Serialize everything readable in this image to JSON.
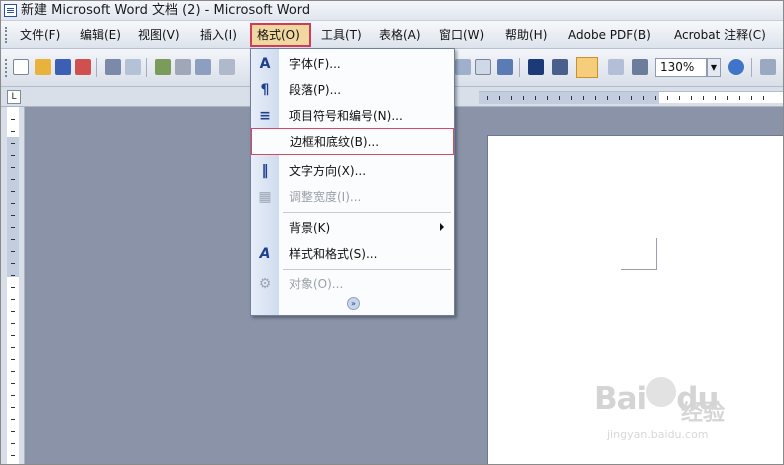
{
  "window": {
    "title": "新建 Microsoft Word 文档 (2) - Microsoft Word"
  },
  "menubar": {
    "items": [
      {
        "label": "文件(F)"
      },
      {
        "label": "编辑(E)"
      },
      {
        "label": "视图(V)"
      },
      {
        "label": "插入(I)"
      },
      {
        "label": "格式(O)"
      },
      {
        "label": "工具(T)"
      },
      {
        "label": "表格(A)"
      },
      {
        "label": "窗口(W)"
      },
      {
        "label": "帮助(H)"
      },
      {
        "label": "Adobe PDF(B)"
      },
      {
        "label": "Acrobat 注释(C)"
      }
    ],
    "active_index": 4
  },
  "toolbar": {
    "zoom_value": "130%",
    "zoom_arrow": "▼"
  },
  "ruler": {
    "tab_button": "L"
  },
  "format_menu": {
    "items": [
      {
        "icon": "A",
        "icon_name": "font-icon",
        "label": "字体(F)...",
        "disabled": false
      },
      {
        "icon": "¶",
        "icon_name": "paragraph-icon",
        "label": "段落(P)...",
        "disabled": false
      },
      {
        "icon": "≡",
        "icon_name": "bullets-numbering-icon",
        "label": "项目符号和编号(N)...",
        "disabled": false
      },
      {
        "icon": "",
        "icon_name": "",
        "label": "边框和底纹(B)...",
        "disabled": false,
        "highlighted": true
      },
      {
        "icon": "‖",
        "icon_name": "text-direction-icon",
        "label": "文字方向(X)...",
        "disabled": false
      },
      {
        "icon": "▦",
        "icon_name": "adjust-width-icon",
        "label": "调整宽度(I)...",
        "disabled": true
      },
      {
        "icon": "",
        "icon_name": "",
        "label": "背景(K)",
        "disabled": false,
        "submenu": true
      },
      {
        "icon": "A",
        "icon_name": "styles-formatting-icon",
        "label": "样式和格式(S)...",
        "disabled": false
      },
      {
        "icon": "⚙",
        "icon_name": "object-icon",
        "label": "对象(O)...",
        "disabled": true
      }
    ],
    "expand_glyph": "»"
  },
  "watermark": {
    "brand": "Bai",
    "brand_tail": "du",
    "cn": "经验",
    "url": "jingyan.baidu.com"
  },
  "colors": {
    "menu_highlight_border": "#d44a63",
    "app_background": "#8a93a8",
    "accent": "#1f3f8f"
  }
}
